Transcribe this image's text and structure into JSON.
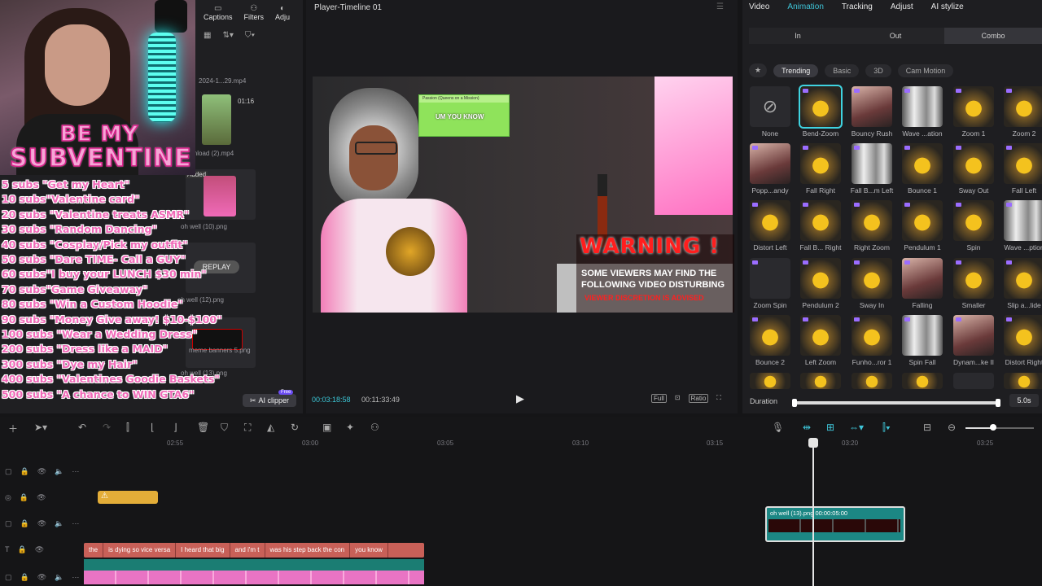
{
  "left_panel": {
    "top_tabs": [
      {
        "label": "Captions",
        "icon": "captions-icon"
      },
      {
        "label": "Filters",
        "icon": "filters-icon"
      },
      {
        "label": "Adju",
        "icon": "adjust-icon"
      }
    ],
    "media": [
      {
        "name": "2024-1...29.mp4",
        "duration": ""
      },
      {
        "name": "wnload (2).mp4",
        "duration": "01:16"
      },
      {
        "name": "oh well (10).png",
        "duration": "",
        "badge": "Added"
      },
      {
        "name": "oh well (12).png",
        "duration": ""
      },
      {
        "name": "oh well (13).png",
        "duration": ""
      },
      {
        "name": "meme banners 5.png",
        "duration": ""
      }
    ],
    "replay_label": "REPLAY",
    "ai_clipper": {
      "label": "AI clipper",
      "badge": "Free"
    }
  },
  "stream_overlay": {
    "title_line1": "BE MY",
    "title_line2": "SUBVENTINE",
    "goals": [
      "5 subs \"Get my Heart\"",
      "10 subs\"Valentine card\"",
      "20 subs \"Valentine treats ASMR\"",
      "30 subs \"Random Dancing\"",
      "40 subs \"Cosplay/Pick my outfit\"",
      "50 subs \"Dare TIME- Call a GUY\"",
      "60 subs\"I buy your LUNCH $30 min\"",
      "70 subs\"Game Giveaway\"",
      "80 subs \"Win a Custom Hoodie\"",
      "90 subs \"Money Give away! $10-$100\"",
      "100 subs \"Wear a Wedding Dress\"",
      "200 subs \"Dress like a MAID\"",
      "300 subs \"Dye my Hair\"",
      "400 subs \"Valentines Goodie Baskets\"",
      "500 subs \"A chance to WIN GTA6\""
    ]
  },
  "player": {
    "title": "Player-Timeline 01",
    "banner_top": "Passion (Queens on a Mission)",
    "banner_text": "UM YOU KNOW",
    "warning_title": "WARNING !",
    "warning_line1": "SOME VIEWERS MAY FIND THE",
    "warning_line2": "FOLLOWING VIDEO DISTURBING",
    "warning_line3": "VIEWER DISCRETION IS ADVISED",
    "current_time": "00:03:18:58",
    "total_time": "00:11:33:49",
    "tools": [
      "Full",
      "Ratio"
    ]
  },
  "right_panel": {
    "tabs": [
      "Video",
      "Animation",
      "Tracking",
      "Adjust",
      "AI stylize"
    ],
    "active_tab": "Animation",
    "io_tabs": [
      "In",
      "Out",
      "Combo"
    ],
    "active_io": "Combo",
    "categories": [
      "Trending",
      "Basic",
      "3D",
      "Cam Motion"
    ],
    "active_category": "Trending",
    "effects": [
      [
        "None",
        "Bend-Zoom",
        "Bouncy Rush",
        "Wave ...ation",
        "Zoom 1",
        "Zoom 2"
      ],
      [
        "Popp...andy",
        "Fall Right",
        "Fall B...m Left",
        "Bounce 1",
        "Sway Out",
        "Fall Left"
      ],
      [
        "Distort Left",
        "Fall B... Right",
        "Right Zoom",
        "Pendulum 1",
        "Spin",
        "Wave ...ption"
      ],
      [
        "Zoom Spin",
        "Pendulum 2",
        "Sway In",
        "Falling",
        "Smaller",
        "Slip a...lide"
      ],
      [
        "Bounce 2",
        "Left Zoom",
        "Funho...ror 1",
        "Spin Fall",
        "Dynam...ke II",
        "Distort Right"
      ]
    ],
    "selected_effect": "Bend-Zoom",
    "duration_label": "Duration",
    "duration_value": "5.0s"
  },
  "timeline": {
    "ruler": [
      "02:55",
      "03:00",
      "03:05",
      "03:10",
      "03:15",
      "03:20",
      "03:25"
    ],
    "overlay_clip_label": "oh well (13).png  00:00:05:00",
    "text_clips": [
      "the",
      "is dying so vice versa",
      "I heard that big",
      "and i'm t",
      "was his step back the con",
      "you know"
    ]
  },
  "colors": {
    "accent": "#3fc6d9",
    "text_clip": "#c86058",
    "overlay_clip": "#1c8784",
    "warning_clip": "#e3ad38"
  }
}
